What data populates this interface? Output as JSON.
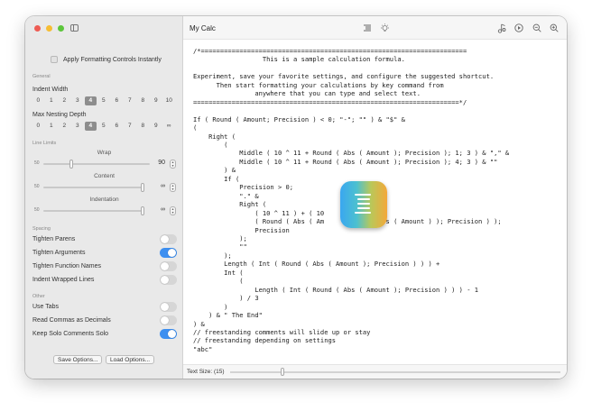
{
  "sidebar": {
    "apply_controls_label": "Apply Formatting Controls Instantly",
    "sections": {
      "general": "General",
      "line_limits": "Line Limits",
      "spacing": "Spacing",
      "other": "Other"
    },
    "indent_width": {
      "label": "Indent Width",
      "options": [
        "0",
        "1",
        "2",
        "3",
        "4",
        "5",
        "6",
        "7",
        "8",
        "9",
        "10"
      ],
      "selected": "4"
    },
    "max_nesting": {
      "label": "Max Nesting Depth",
      "options": [
        "0",
        "1",
        "2",
        "3",
        "4",
        "5",
        "6",
        "7",
        "8",
        "9",
        "∞"
      ],
      "selected": "4"
    },
    "wrap": {
      "label": "Wrap",
      "min": "50",
      "value": "90"
    },
    "content": {
      "label": "Content",
      "min": "50",
      "value": "∞"
    },
    "indentation": {
      "label": "Indentation",
      "min": "50",
      "value": "∞"
    },
    "spacing_toggles": [
      {
        "label": "Tighten Parens",
        "on": false
      },
      {
        "label": "Tighten Arguments",
        "on": true
      },
      {
        "label": "Tighten Function Names",
        "on": false
      },
      {
        "label": "Indent Wrapped Lines",
        "on": false
      }
    ],
    "other_toggles": [
      {
        "label": "Use Tabs",
        "on": false
      },
      {
        "label": "Read Commas as Decimals",
        "on": false
      },
      {
        "label": "Keep Solo Comments Solo",
        "on": true
      }
    ],
    "save_label": "Save Options...",
    "load_label": "Load Options..."
  },
  "main": {
    "title": "My Calc",
    "icons": [
      "format-lines-icon",
      "lightbulb-icon",
      "music-note-icon",
      "play-icon",
      "zoom-out-icon",
      "zoom-in-icon"
    ],
    "code": "/*=====================================================================\n                  This is a sample calculation formula.\n\nExperiment, save your favorite settings, and configure the suggested shortcut.\n      Then start formatting your calculations by key command from\n                anywhere that you can type and select text.\n=====================================================================*/\n\nIf ( Round ( Amount; Precision ) < 0; \"-\"; \"\" ) & \"$\" &\n(\n    Right (\n        (\n            Middle ( 10 ^ 11 + Round ( Abs ( Amount ); Precision ); 1; 3 ) & \",\" &\n            Middle ( 10 ^ 11 + Round ( Abs ( Amount ); Precision ); 4; 3 ) & \"\"\n        ) &\n        If (\n            Precision > 0;\n            \".\" &\n            Right (\n                ( 10 ^ 11 ) + ( 10              *\n                ( Round ( Abs ( Am              Abs ( Amount ) ); Precision ) );\n                Precision\n            );\n            \"\"\n        );\n        Length ( Int ( Round ( Abs ( Amount ); Precision ) ) ) +\n        Int (\n            (\n                Length ( Int ( Round ( Abs ( Amount ); Precision ) ) ) - 1\n            ) / 3\n        )\n    ) & \" The End\"\n) &\n// freestanding comments will slide up or stay\n// freestanding depending on settings\n\"abc\"",
    "text_size_label": "Text Size: (15)"
  },
  "colors": {
    "accent": "#3d8ff0",
    "sidebar_bg": "#e9e9e9"
  }
}
